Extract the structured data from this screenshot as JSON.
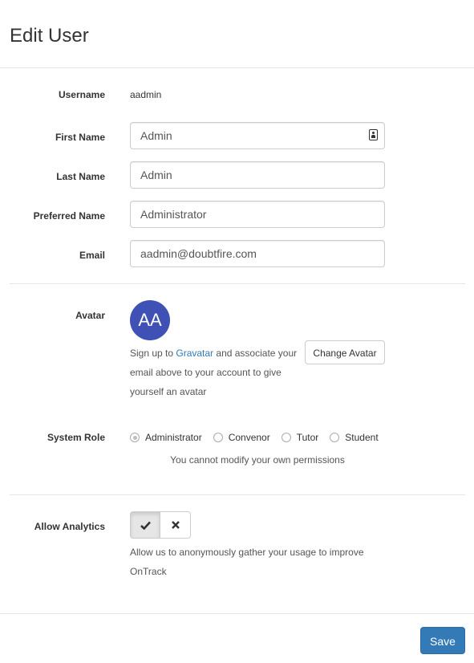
{
  "header": {
    "title": "Edit User"
  },
  "form": {
    "username": {
      "label": "Username",
      "value": "aadmin"
    },
    "first_name": {
      "label": "First Name",
      "value": "Admin"
    },
    "last_name": {
      "label": "Last Name",
      "value": "Admin"
    },
    "preferred_name": {
      "label": "Preferred Name",
      "value": "Administrator"
    },
    "email": {
      "label": "Email",
      "value": "aadmin@doubtfire.com"
    }
  },
  "avatar": {
    "label": "Avatar",
    "initials": "AA",
    "color": "#3f51b5",
    "help_prefix": "Sign up to ",
    "help_link": "Gravatar",
    "help_suffix": " and associate your email above to your account to give yourself an avatar",
    "change_button": "Change Avatar"
  },
  "system_role": {
    "label": "System Role",
    "options": [
      "Administrator",
      "Convenor",
      "Tutor",
      "Student"
    ],
    "selected": "Administrator",
    "note": "You cannot modify your own permissions"
  },
  "analytics": {
    "label": "Allow Analytics",
    "enabled": true,
    "on_icon": "check-icon",
    "off_icon": "times-icon",
    "help": "Allow us to anonymously gather your usage to improve OnTrack"
  },
  "footer": {
    "save_button": "Save"
  },
  "colors": {
    "primary": "#337ab7",
    "border": "#cccccc"
  }
}
